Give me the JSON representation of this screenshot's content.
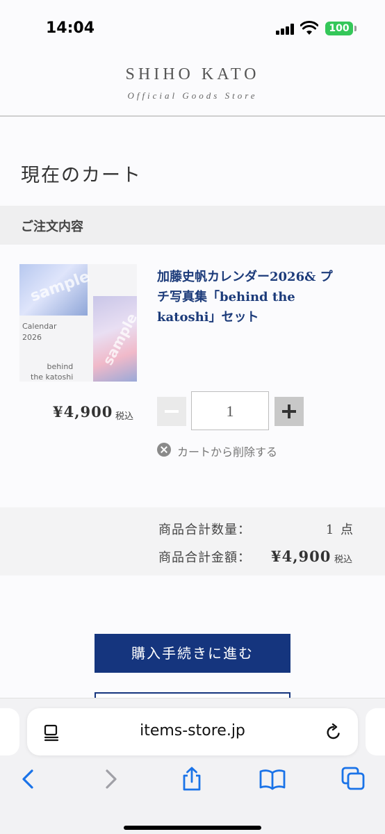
{
  "status_bar": {
    "time": "14:04",
    "battery": "100"
  },
  "header": {
    "brand": "SHIHO KATO",
    "subtitle": "Official Goods Store"
  },
  "cart": {
    "title": "現在のカート",
    "section_label": "ご注文内容",
    "item": {
      "image_text_1": "Calendar",
      "image_text_2": "2026",
      "image_text_3": "behind",
      "image_text_4": "the katoshi",
      "watermark": "sample",
      "name_line_1": "加藤史帆カレンダー2026& プ",
      "name_line_2": "チ写真集「behind the",
      "name_line_3": "katoshi」セット",
      "price": "¥4,900",
      "tax_note": "税込",
      "quantity": "1",
      "remove_label": "カートから削除する"
    },
    "totals": {
      "count_label": "商品合計数量：",
      "count_value": "1 点",
      "amount_label": "商品合計金額：",
      "amount_value": "¥4,900",
      "tax_note": "税込"
    },
    "checkout_label": "購入手続きに進む"
  },
  "browser": {
    "url": "items-store.jp"
  },
  "colors": {
    "navy": "#15357e",
    "product_name": "#1c3b7a",
    "battery_green": "#34c759",
    "ios_blue": "#1a73e8"
  }
}
